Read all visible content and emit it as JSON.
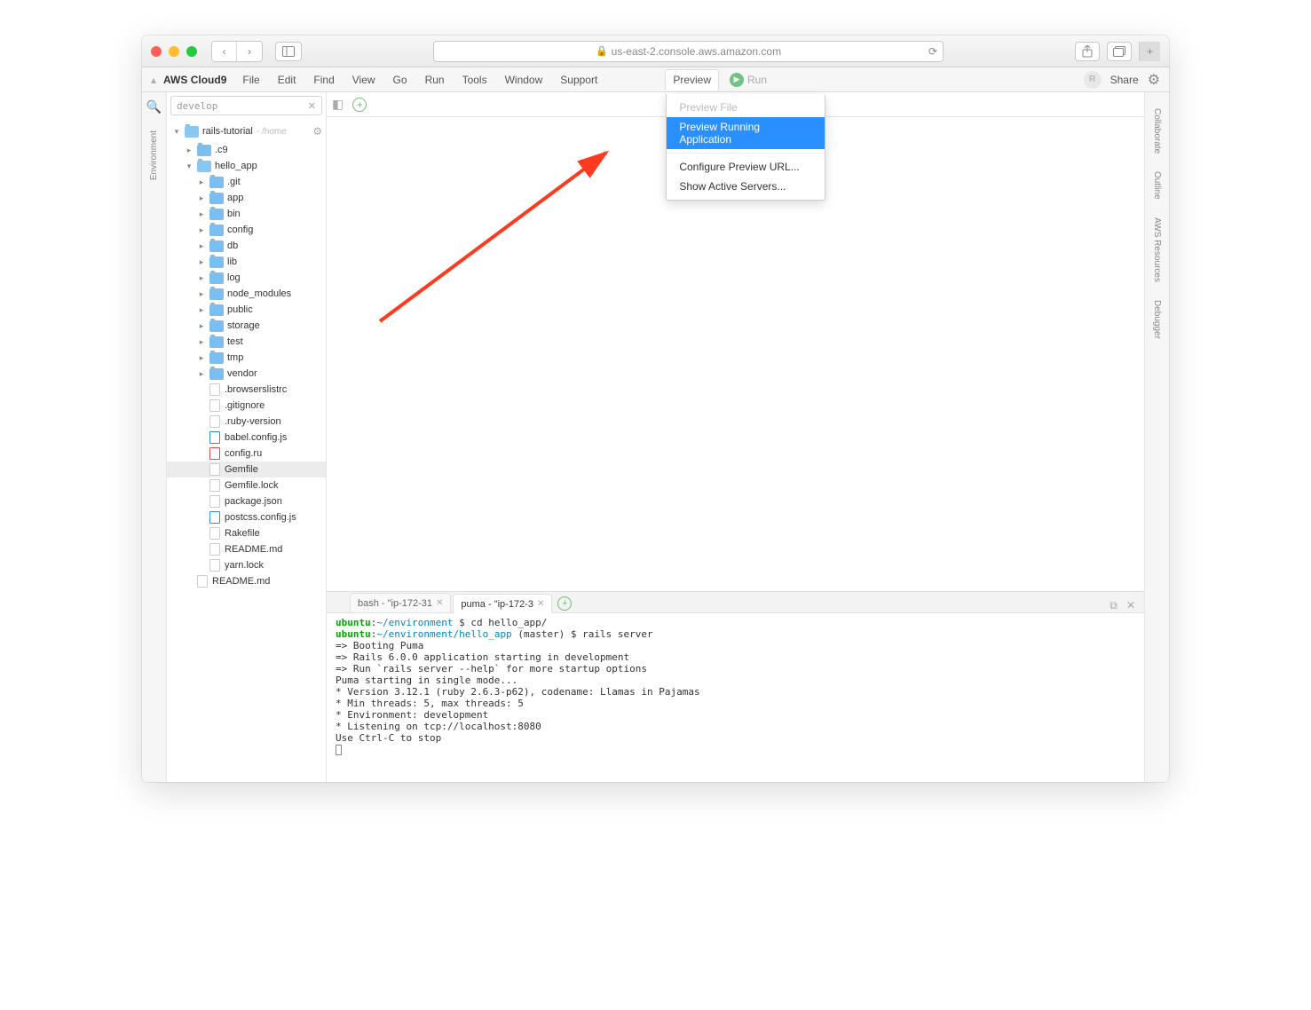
{
  "browser": {
    "url": "us-east-2.console.aws.amazon.com"
  },
  "menubar": {
    "brand": "AWS Cloud9",
    "items": [
      "File",
      "Edit",
      "Find",
      "View",
      "Go",
      "Run",
      "Tools",
      "Window",
      "Support"
    ],
    "preview": "Preview",
    "run": "Run",
    "share": "Share",
    "avatar_initial": "R"
  },
  "dropdown": {
    "preview_file": "Preview File",
    "preview_running": "Preview Running Application",
    "configure": "Configure Preview URL...",
    "show_servers": "Show Active Servers..."
  },
  "sidebar": {
    "search_value": "develop",
    "root_name": "rails-tutorial",
    "root_meta": "- /home",
    "tree": [
      {
        "type": "folder",
        "name": ".c9",
        "depth": 2,
        "open": false
      },
      {
        "type": "folder",
        "name": "hello_app",
        "depth": 2,
        "open": true
      },
      {
        "type": "folder",
        "name": ".git",
        "depth": 3,
        "open": false
      },
      {
        "type": "folder",
        "name": "app",
        "depth": 3,
        "open": false
      },
      {
        "type": "folder",
        "name": "bin",
        "depth": 3,
        "open": false
      },
      {
        "type": "folder",
        "name": "config",
        "depth": 3,
        "open": false
      },
      {
        "type": "folder",
        "name": "db",
        "depth": 3,
        "open": false
      },
      {
        "type": "folder",
        "name": "lib",
        "depth": 3,
        "open": false
      },
      {
        "type": "folder",
        "name": "log",
        "depth": 3,
        "open": false
      },
      {
        "type": "folder",
        "name": "node_modules",
        "depth": 3,
        "open": false
      },
      {
        "type": "folder",
        "name": "public",
        "depth": 3,
        "open": false
      },
      {
        "type": "folder",
        "name": "storage",
        "depth": 3,
        "open": false
      },
      {
        "type": "folder",
        "name": "test",
        "depth": 3,
        "open": false
      },
      {
        "type": "folder",
        "name": "tmp",
        "depth": 3,
        "open": false
      },
      {
        "type": "folder",
        "name": "vendor",
        "depth": 3,
        "open": false
      },
      {
        "type": "file",
        "name": ".browserslistrc",
        "depth": 3,
        "kind": "plain"
      },
      {
        "type": "file",
        "name": ".gitignore",
        "depth": 3,
        "kind": "plain"
      },
      {
        "type": "file",
        "name": ".ruby-version",
        "depth": 3,
        "kind": "plain"
      },
      {
        "type": "file",
        "name": "babel.config.js",
        "depth": 3,
        "kind": "js"
      },
      {
        "type": "file",
        "name": "config.ru",
        "depth": 3,
        "kind": "ruby"
      },
      {
        "type": "file",
        "name": "Gemfile",
        "depth": 3,
        "kind": "plain",
        "selected": true
      },
      {
        "type": "file",
        "name": "Gemfile.lock",
        "depth": 3,
        "kind": "plain"
      },
      {
        "type": "file",
        "name": "package.json",
        "depth": 3,
        "kind": "plain"
      },
      {
        "type": "file",
        "name": "postcss.config.js",
        "depth": 3,
        "kind": "js"
      },
      {
        "type": "file",
        "name": "Rakefile",
        "depth": 3,
        "kind": "plain"
      },
      {
        "type": "file",
        "name": "README.md",
        "depth": 3,
        "kind": "plain"
      },
      {
        "type": "file",
        "name": "yarn.lock",
        "depth": 3,
        "kind": "plain"
      },
      {
        "type": "file",
        "name": "README.md",
        "depth": 2,
        "kind": "plain"
      }
    ]
  },
  "left_tabs": [
    "Environment"
  ],
  "right_tabs": [
    "Collaborate",
    "Outline",
    "AWS Resources",
    "Debugger"
  ],
  "terminal": {
    "tabs": [
      {
        "label": "bash - \"ip-172-31",
        "active": false
      },
      {
        "label": "puma - \"ip-172-3",
        "active": true
      }
    ],
    "lines": [
      {
        "segs": [
          {
            "c": "u",
            "t": "ubuntu"
          },
          {
            "t": ":"
          },
          {
            "c": "p",
            "t": "~/environment"
          },
          {
            "t": " $ cd hello_app/"
          }
        ]
      },
      {
        "segs": [
          {
            "c": "u",
            "t": "ubuntu"
          },
          {
            "t": ":"
          },
          {
            "c": "p",
            "t": "~/environment/hello_app"
          },
          {
            "t": " (master) $ rails server"
          }
        ]
      },
      {
        "segs": [
          {
            "t": "=> Booting Puma"
          }
        ]
      },
      {
        "segs": [
          {
            "t": "=> Rails 6.0.0 application starting in development"
          }
        ]
      },
      {
        "segs": [
          {
            "t": "=> Run `rails server --help` for more startup options"
          }
        ]
      },
      {
        "segs": [
          {
            "t": "Puma starting in single mode..."
          }
        ]
      },
      {
        "segs": [
          {
            "t": "* Version 3.12.1 (ruby 2.6.3-p62), codename: Llamas in Pajamas"
          }
        ]
      },
      {
        "segs": [
          {
            "t": "* Min threads: 5, max threads: 5"
          }
        ]
      },
      {
        "segs": [
          {
            "t": "* Environment: development"
          }
        ]
      },
      {
        "segs": [
          {
            "t": "* Listening on tcp://localhost:8080"
          }
        ]
      },
      {
        "segs": [
          {
            "t": "Use Ctrl-C to stop"
          }
        ]
      }
    ]
  }
}
